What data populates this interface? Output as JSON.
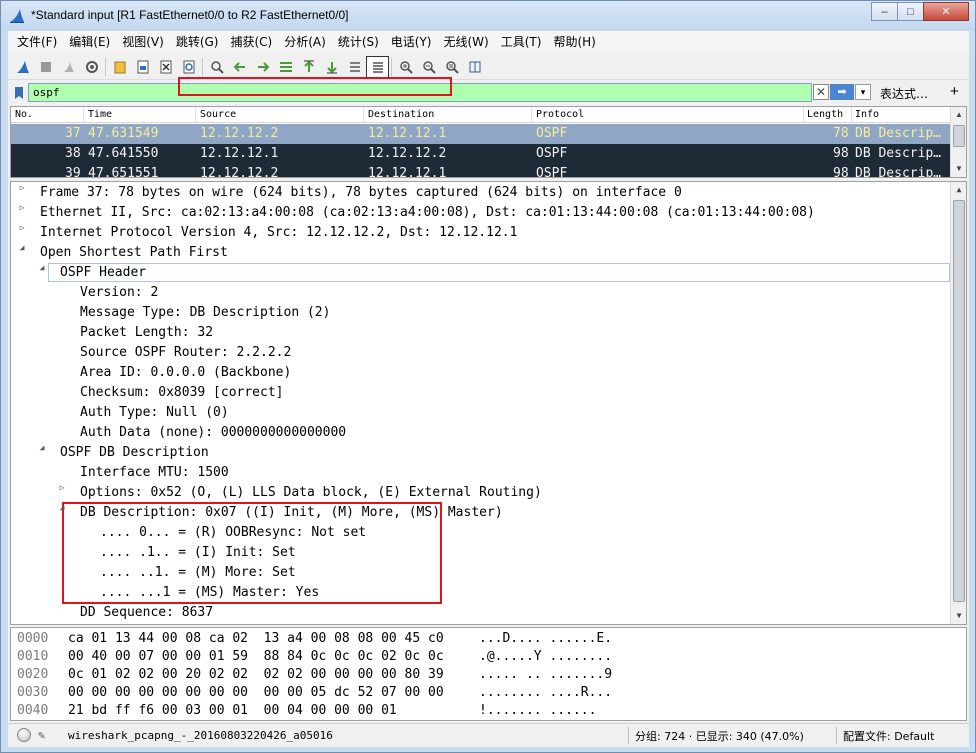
{
  "window": {
    "title": "*Standard input [R1 FastEthernet0/0 to R2 FastEthernet0/0]",
    "minimize": "–",
    "maximize": "□",
    "close": "✕"
  },
  "menu": [
    "文件(F)",
    "编辑(E)",
    "视图(V)",
    "跳转(G)",
    "捕获(C)",
    "分析(A)",
    "统计(S)",
    "电话(Y)",
    "无线(W)",
    "工具(T)",
    "帮助(H)"
  ],
  "filter": {
    "value": "ospf",
    "clear": "✕",
    "apply": "➡",
    "dropdown": "▾",
    "expression_label": "表达式…",
    "add": "+"
  },
  "packet_list": {
    "columns": [
      "No.",
      "Time",
      "Source",
      "Destination",
      "Protocol",
      "Length",
      "Info"
    ],
    "rows": [
      {
        "no": "37",
        "time": "47.631549",
        "src": "12.12.12.2",
        "dst": "12.12.12.1",
        "proto": "OSPF",
        "len": "78",
        "info": "DB Descrip…"
      },
      {
        "no": "38",
        "time": "47.641550",
        "src": "12.12.12.1",
        "dst": "12.12.12.2",
        "proto": "OSPF",
        "len": "98",
        "info": "DB Descrip…"
      },
      {
        "no": "39",
        "time": "47.651551",
        "src": "12.12.12.2",
        "dst": "12.12.12.1",
        "proto": "OSPF",
        "len": "98",
        "info": "DB Descrip…"
      }
    ]
  },
  "details": [
    {
      "text": "Frame 37: 78 bytes on wire (624 bits), 78 bytes captured (624 bits) on interface 0",
      "toggle": "▷"
    },
    {
      "text": "Ethernet II, Src: ca:02:13:a4:00:08 (ca:02:13:a4:00:08), Dst: ca:01:13:44:00:08 (ca:01:13:44:00:08)",
      "toggle": "▷"
    },
    {
      "text": "Internet Protocol Version 4, Src: 12.12.12.2, Dst: 12.12.12.1",
      "toggle": "▷"
    },
    {
      "text": "Open Shortest Path First",
      "toggle": "◢"
    },
    {
      "text": "OSPF Header",
      "toggle": "◢"
    },
    {
      "text": "Version: 2",
      "toggle": ""
    },
    {
      "text": "Message Type: DB Description (2)",
      "toggle": ""
    },
    {
      "text": "Packet Length: 32",
      "toggle": ""
    },
    {
      "text": "Source OSPF Router: 2.2.2.2",
      "toggle": ""
    },
    {
      "text": "Area ID: 0.0.0.0 (Backbone)",
      "toggle": ""
    },
    {
      "text": "Checksum: 0x8039 [correct]",
      "toggle": ""
    },
    {
      "text": "Auth Type: Null (0)",
      "toggle": ""
    },
    {
      "text": "Auth Data (none): 0000000000000000",
      "toggle": ""
    },
    {
      "text": "OSPF DB Description",
      "toggle": "◢"
    },
    {
      "text": "Interface MTU: 1500",
      "toggle": ""
    },
    {
      "text": "Options: 0x52 (O, (L) LLS Data block, (E) External Routing)",
      "toggle": "▷"
    },
    {
      "text": "DB Description: 0x07 ((I) Init, (M) More, (MS) Master)",
      "toggle": "◢"
    },
    {
      "text": ".... 0... = (R) OOBResync: Not set",
      "toggle": ""
    },
    {
      "text": ".... .1.. = (I) Init: Set",
      "toggle": ""
    },
    {
      "text": ".... ..1. = (M) More: Set",
      "toggle": ""
    },
    {
      "text": ".... ...1 = (MS) Master: Yes",
      "toggle": ""
    },
    {
      "text": "DD Sequence: 8637",
      "toggle": ""
    }
  ],
  "bytes": [
    {
      "offset": "0000",
      "hex": "ca 01 13 44 00 08 ca 02  13 a4 00 08 08 00 45 c0",
      "ascii": "...D.... ......E."
    },
    {
      "offset": "0010",
      "hex": "00 40 00 07 00 00 01 59  88 84 0c 0c 0c 02 0c 0c",
      "ascii": ".@.....Y ........"
    },
    {
      "offset": "0020",
      "hex": "0c 01 02 02 00 20 02 02  02 02 00 00 00 00 80 39",
      "ascii": "..... .. .......9"
    },
    {
      "offset": "0030",
      "hex": "00 00 00 00 00 00 00 00  00 00 05 dc 52 07 00 00",
      "ascii": "........ ....R..."
    },
    {
      "offset": "0040",
      "hex": "21 bd ff f6 00 03 00 01  00 04 00 00 00 01",
      "ascii": "!....... ......"
    }
  ],
  "status": {
    "file": "wireshark_pcapng_-_20160803220426_a05016",
    "packets": "分组: 724 · 已显示: 340 (47.0%)",
    "profile": "配置文件: Default"
  }
}
